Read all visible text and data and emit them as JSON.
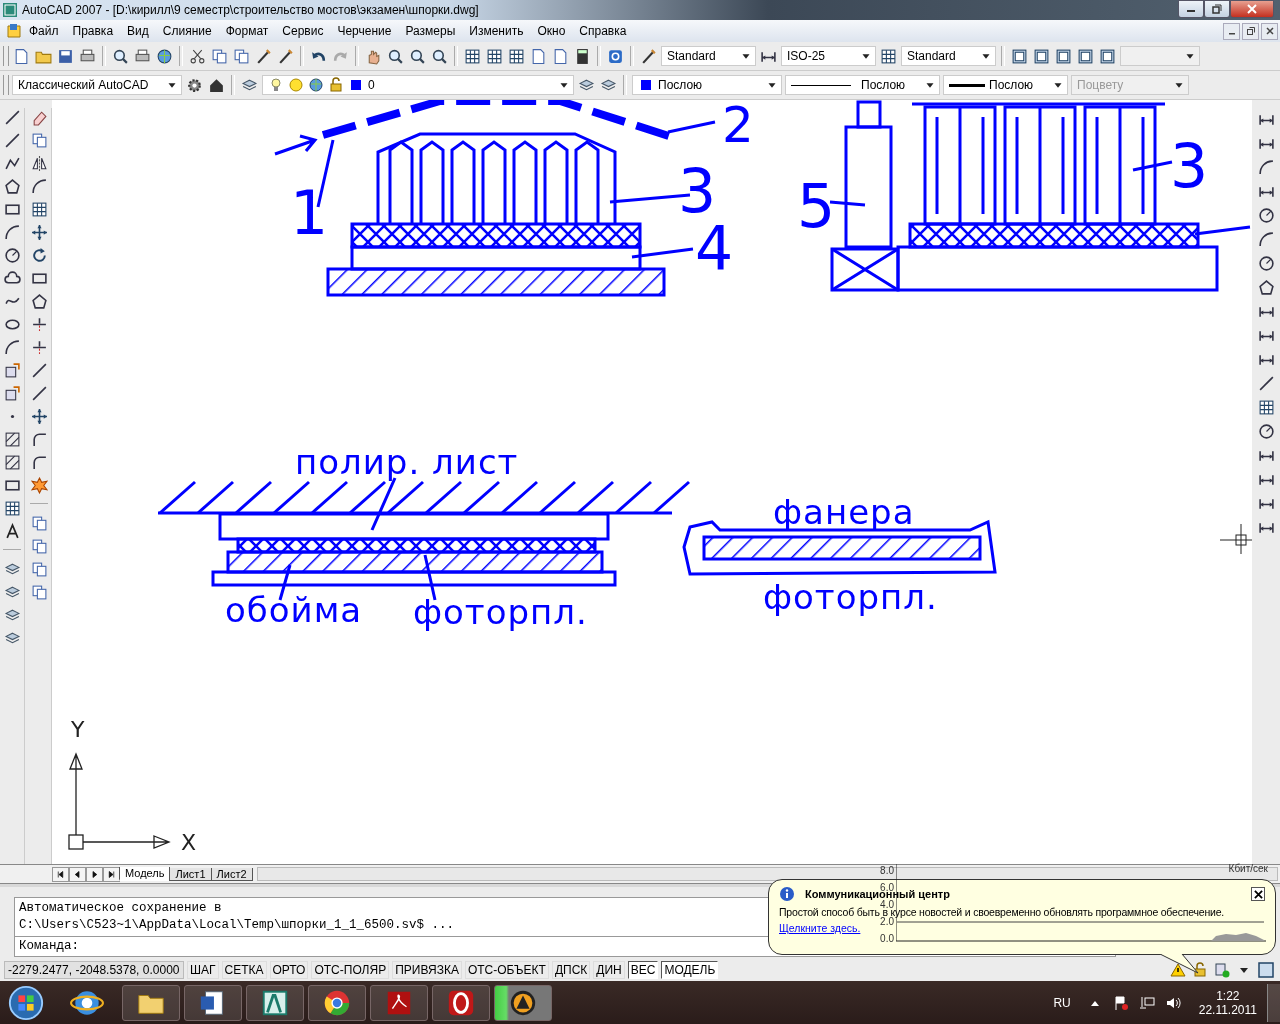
{
  "window": {
    "title": "AutoCAD 2007 - [D:\\кирилл\\9 семестр\\строительство мостов\\экзамен\\шпорки.dwg]"
  },
  "menu": [
    "Файл",
    "Правка",
    "Вид",
    "Слияние",
    "Формат",
    "Сервис",
    "Черчение",
    "Размеры",
    "Изменить",
    "Окно",
    "Справка"
  ],
  "styles": {
    "text_style": "Standard",
    "dim_style": "ISO-25",
    "table_style": "Standard"
  },
  "workspace": "Классический AutoCAD",
  "layer": "0",
  "properties": {
    "color_setting": "Послою",
    "linetype": "Послою",
    "lineweight": "Послою",
    "plot_style": "Поцвету",
    "plot_style_disabled": true
  },
  "drawing_labels": [
    "1",
    "2",
    "3",
    "4",
    "5",
    "3",
    "полир. лист",
    "обойма",
    "фоторпл.",
    "фанера",
    "фоторпл."
  ],
  "axis_labels": [
    "Y",
    "X"
  ],
  "layout_tabs": [
    {
      "label": "Модель",
      "selected": true
    },
    {
      "label": "Лист1",
      "selected": false
    },
    {
      "label": "Лист2",
      "selected": false
    }
  ],
  "command_history": [
    "Автоматическое сохранение в",
    "C:\\Users\\C523~1\\AppData\\Local\\Temp\\шпорки_1_1_6500.sv$ ..."
  ],
  "command_prompt": "Команда:",
  "coordinates": "-2279.2477, -2048.5378, 0.0000",
  "status_toggles": [
    {
      "label": "ШАГ",
      "on": false
    },
    {
      "label": "СЕТКА",
      "on": false
    },
    {
      "label": "ОРТО",
      "on": false
    },
    {
      "label": "ОТС-ПОЛЯР",
      "on": false
    },
    {
      "label": "ПРИВЯЗКА",
      "on": false
    },
    {
      "label": "ОТС-ОБЪЕКТ",
      "on": false
    },
    {
      "label": "ДПСК",
      "on": false
    },
    {
      "label": "ДИН",
      "on": false
    },
    {
      "label": "ВЕС",
      "on": true
    },
    {
      "label": "МОДЕЛЬ",
      "on": true
    }
  ],
  "network_meter": {
    "unit": "Кбит/сек",
    "ticks": [
      "8.0",
      "6.0",
      "4.0",
      "2.0",
      "0.0"
    ]
  },
  "balloon": {
    "title": "Коммуникационный центр",
    "text": "Простой способ быть в курсе новостей и своевременно обновлять программное обеспечение.",
    "link": "Щелкните здесь."
  },
  "taskbar": {
    "language": "RU",
    "time": "1:22",
    "date": "22.11.2011"
  }
}
